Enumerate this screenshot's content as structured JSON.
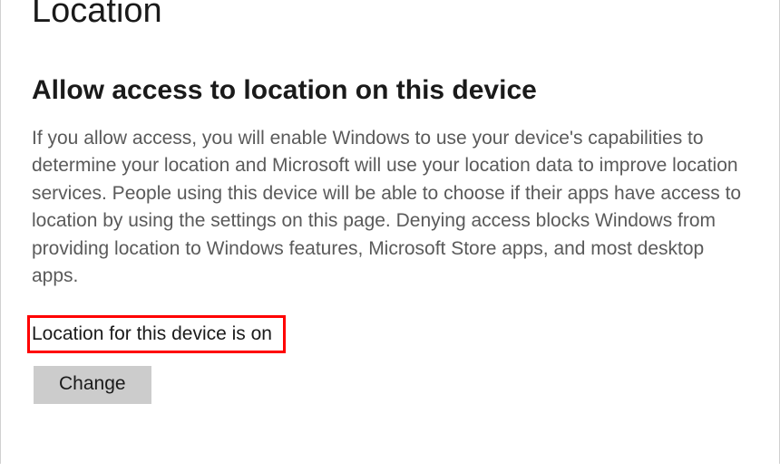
{
  "page": {
    "title": "Location"
  },
  "section": {
    "heading": "Allow access to location on this device",
    "description": "If you allow access, you will enable Windows to use your device's capabilities to determine your location and Microsoft will use your location data to improve location services. People using this device will be able to choose if their apps have access to location by using the settings on this page. Denying access blocks Windows from providing location to Windows features, Microsoft Store apps, and most desktop apps.",
    "status": "Location for this device is on",
    "change_button_label": "Change"
  },
  "annotation": {
    "highlight_color": "#ff0000"
  }
}
